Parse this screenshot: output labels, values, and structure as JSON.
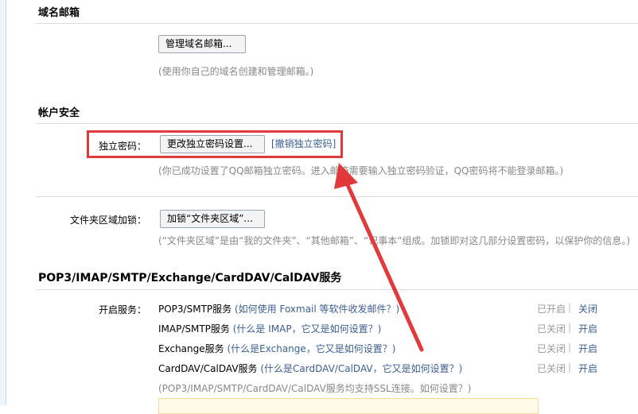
{
  "domain_mail": {
    "title": "域名邮箱",
    "manage_button": "管理域名邮箱...",
    "hint": "(使用你自己的域名创建和管理邮箱。)"
  },
  "account_security": {
    "title": "帐户安全",
    "independent_password": {
      "label": "独立密码：",
      "change_button": "更改独立密码设置...",
      "revoke_link": "[撤销独立密码]",
      "hint": "(你已成功设置了QQ邮箱独立密码。进入邮箱需要输入独立密码验证，QQ密码将不能登录邮箱。)"
    },
    "folder_lock": {
      "label": "文件夹区域加锁：",
      "lock_button": "加锁“文件夹区域”...",
      "hint": "(“文件夹区域”是由“我的文件夹”、“其他邮箱”、“记事本”组成。加锁即对这几部分设置密码，以保护你的信息。)"
    }
  },
  "services": {
    "title": "POP3/IMAP/SMTP/Exchange/CardDAV/CalDAV服务",
    "label": "开启服务：",
    "items": [
      {
        "name": "POP3/SMTP服务",
        "help": "(如何使用 Foxmail 等软件收发邮件？)",
        "status": "已开启",
        "action": "关闭"
      },
      {
        "name": "IMAP/SMTP服务",
        "help": "(什么是 IMAP，它又是如何设置？)",
        "status": "已关闭",
        "action": "开启"
      },
      {
        "name": "Exchange服务",
        "help": "(什么是Exchange，它又是如何设置？)",
        "status": "已关闭",
        "action": "开启"
      },
      {
        "name": "CardDAV/CalDAV服务",
        "help": "(什么是CardDAV/CalDAV，它又是如何设置？)",
        "status": "已关闭",
        "action": "开启"
      }
    ],
    "ssl_note": "(POP3/IMAP/SMTP/CardDAV/CalDAV服务均支持SSL连接。如何设置？)",
    "separator": "|"
  },
  "colors": {
    "highlight": "#e23a3a",
    "link": "#3b5f8f"
  }
}
